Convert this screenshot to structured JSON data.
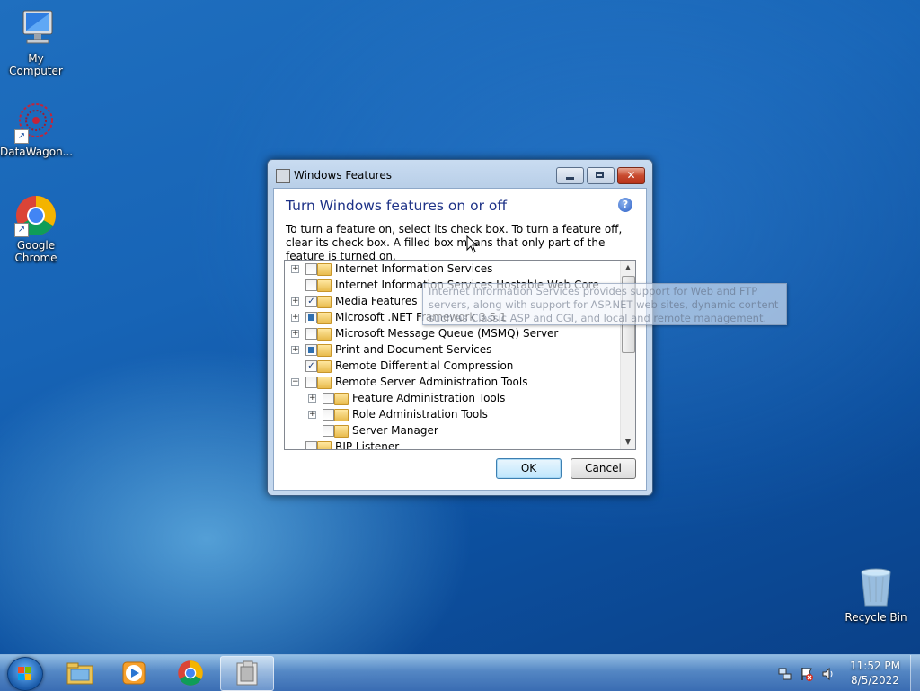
{
  "desktop": {
    "icons": [
      {
        "label": "My Computer",
        "icon": "computer-icon"
      },
      {
        "label": "DataWagon...",
        "icon": "datawagon-icon"
      },
      {
        "label": "Google Chrome",
        "icon": "chrome-icon"
      },
      {
        "label": "Recycle Bin",
        "icon": "recycle-bin-icon"
      }
    ]
  },
  "dialog": {
    "title": "Windows Features",
    "heading": "Turn Windows features on or off",
    "description": "To turn a feature on, select its check box. To turn a feature off, clear its check box. A filled box means that only part of the feature is turned on.",
    "features": [
      {
        "label": "Internet Information Services",
        "state": "unchecked",
        "expander": "+"
      },
      {
        "label": "Internet Information Services Hostable Web Core",
        "state": "unchecked",
        "expander": ""
      },
      {
        "label": "Media Features",
        "state": "checked",
        "expander": "+"
      },
      {
        "label": "Microsoft .NET Framework 3.5.1",
        "state": "partial",
        "expander": "+"
      },
      {
        "label": "Microsoft Message Queue (MSMQ) Server",
        "state": "unchecked",
        "expander": "+"
      },
      {
        "label": "Print and Document Services",
        "state": "partial",
        "expander": "+"
      },
      {
        "label": "Remote Differential Compression",
        "state": "checked",
        "expander": ""
      },
      {
        "label": "Remote Server Administration Tools",
        "state": "unchecked",
        "expander": "−"
      },
      {
        "label": "Feature Administration Tools",
        "state": "unchecked",
        "expander": "+",
        "indent": 1
      },
      {
        "label": "Role Administration Tools",
        "state": "unchecked",
        "expander": "+",
        "indent": 1
      },
      {
        "label": "Server Manager",
        "state": "unchecked",
        "expander": "",
        "indent": 1
      },
      {
        "label": "RIP Listener",
        "state": "unchecked",
        "expander": ""
      }
    ],
    "tooltip": "Internet Information Services provides support for Web and FTP servers, along with support for ASP.NET web sites, dynamic content such as Classic ASP and CGI, and local and remote management.",
    "ok_label": "OK",
    "cancel_label": "Cancel",
    "close_glyph": "✕"
  },
  "taskbar": {
    "pinned": [
      "explorer-icon",
      "media-player-icon",
      "chrome-icon",
      "windows-features-icon"
    ],
    "clock_time": "11:52 PM",
    "clock_date": "8/5/2022"
  }
}
